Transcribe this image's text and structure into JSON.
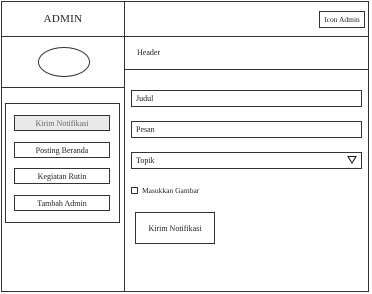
{
  "sidebar": {
    "brand": "ADMIN",
    "menu": [
      {
        "label": "Kirim Notifikasi",
        "active": true
      },
      {
        "label": "Posting Beranda",
        "active": false
      },
      {
        "label": "Kegiatan Rutin",
        "active": false
      },
      {
        "label": "Tambah Admin",
        "active": false
      }
    ]
  },
  "topbar": {
    "icon_admin_label": "Icon Admin"
  },
  "main": {
    "header": "Header",
    "fields": {
      "judul": "Judul",
      "pesan": "Pesan",
      "topik": "Topik"
    },
    "checkbox_label": "Masukkan Gambar",
    "submit_label": "Kirim Notifikasi"
  }
}
